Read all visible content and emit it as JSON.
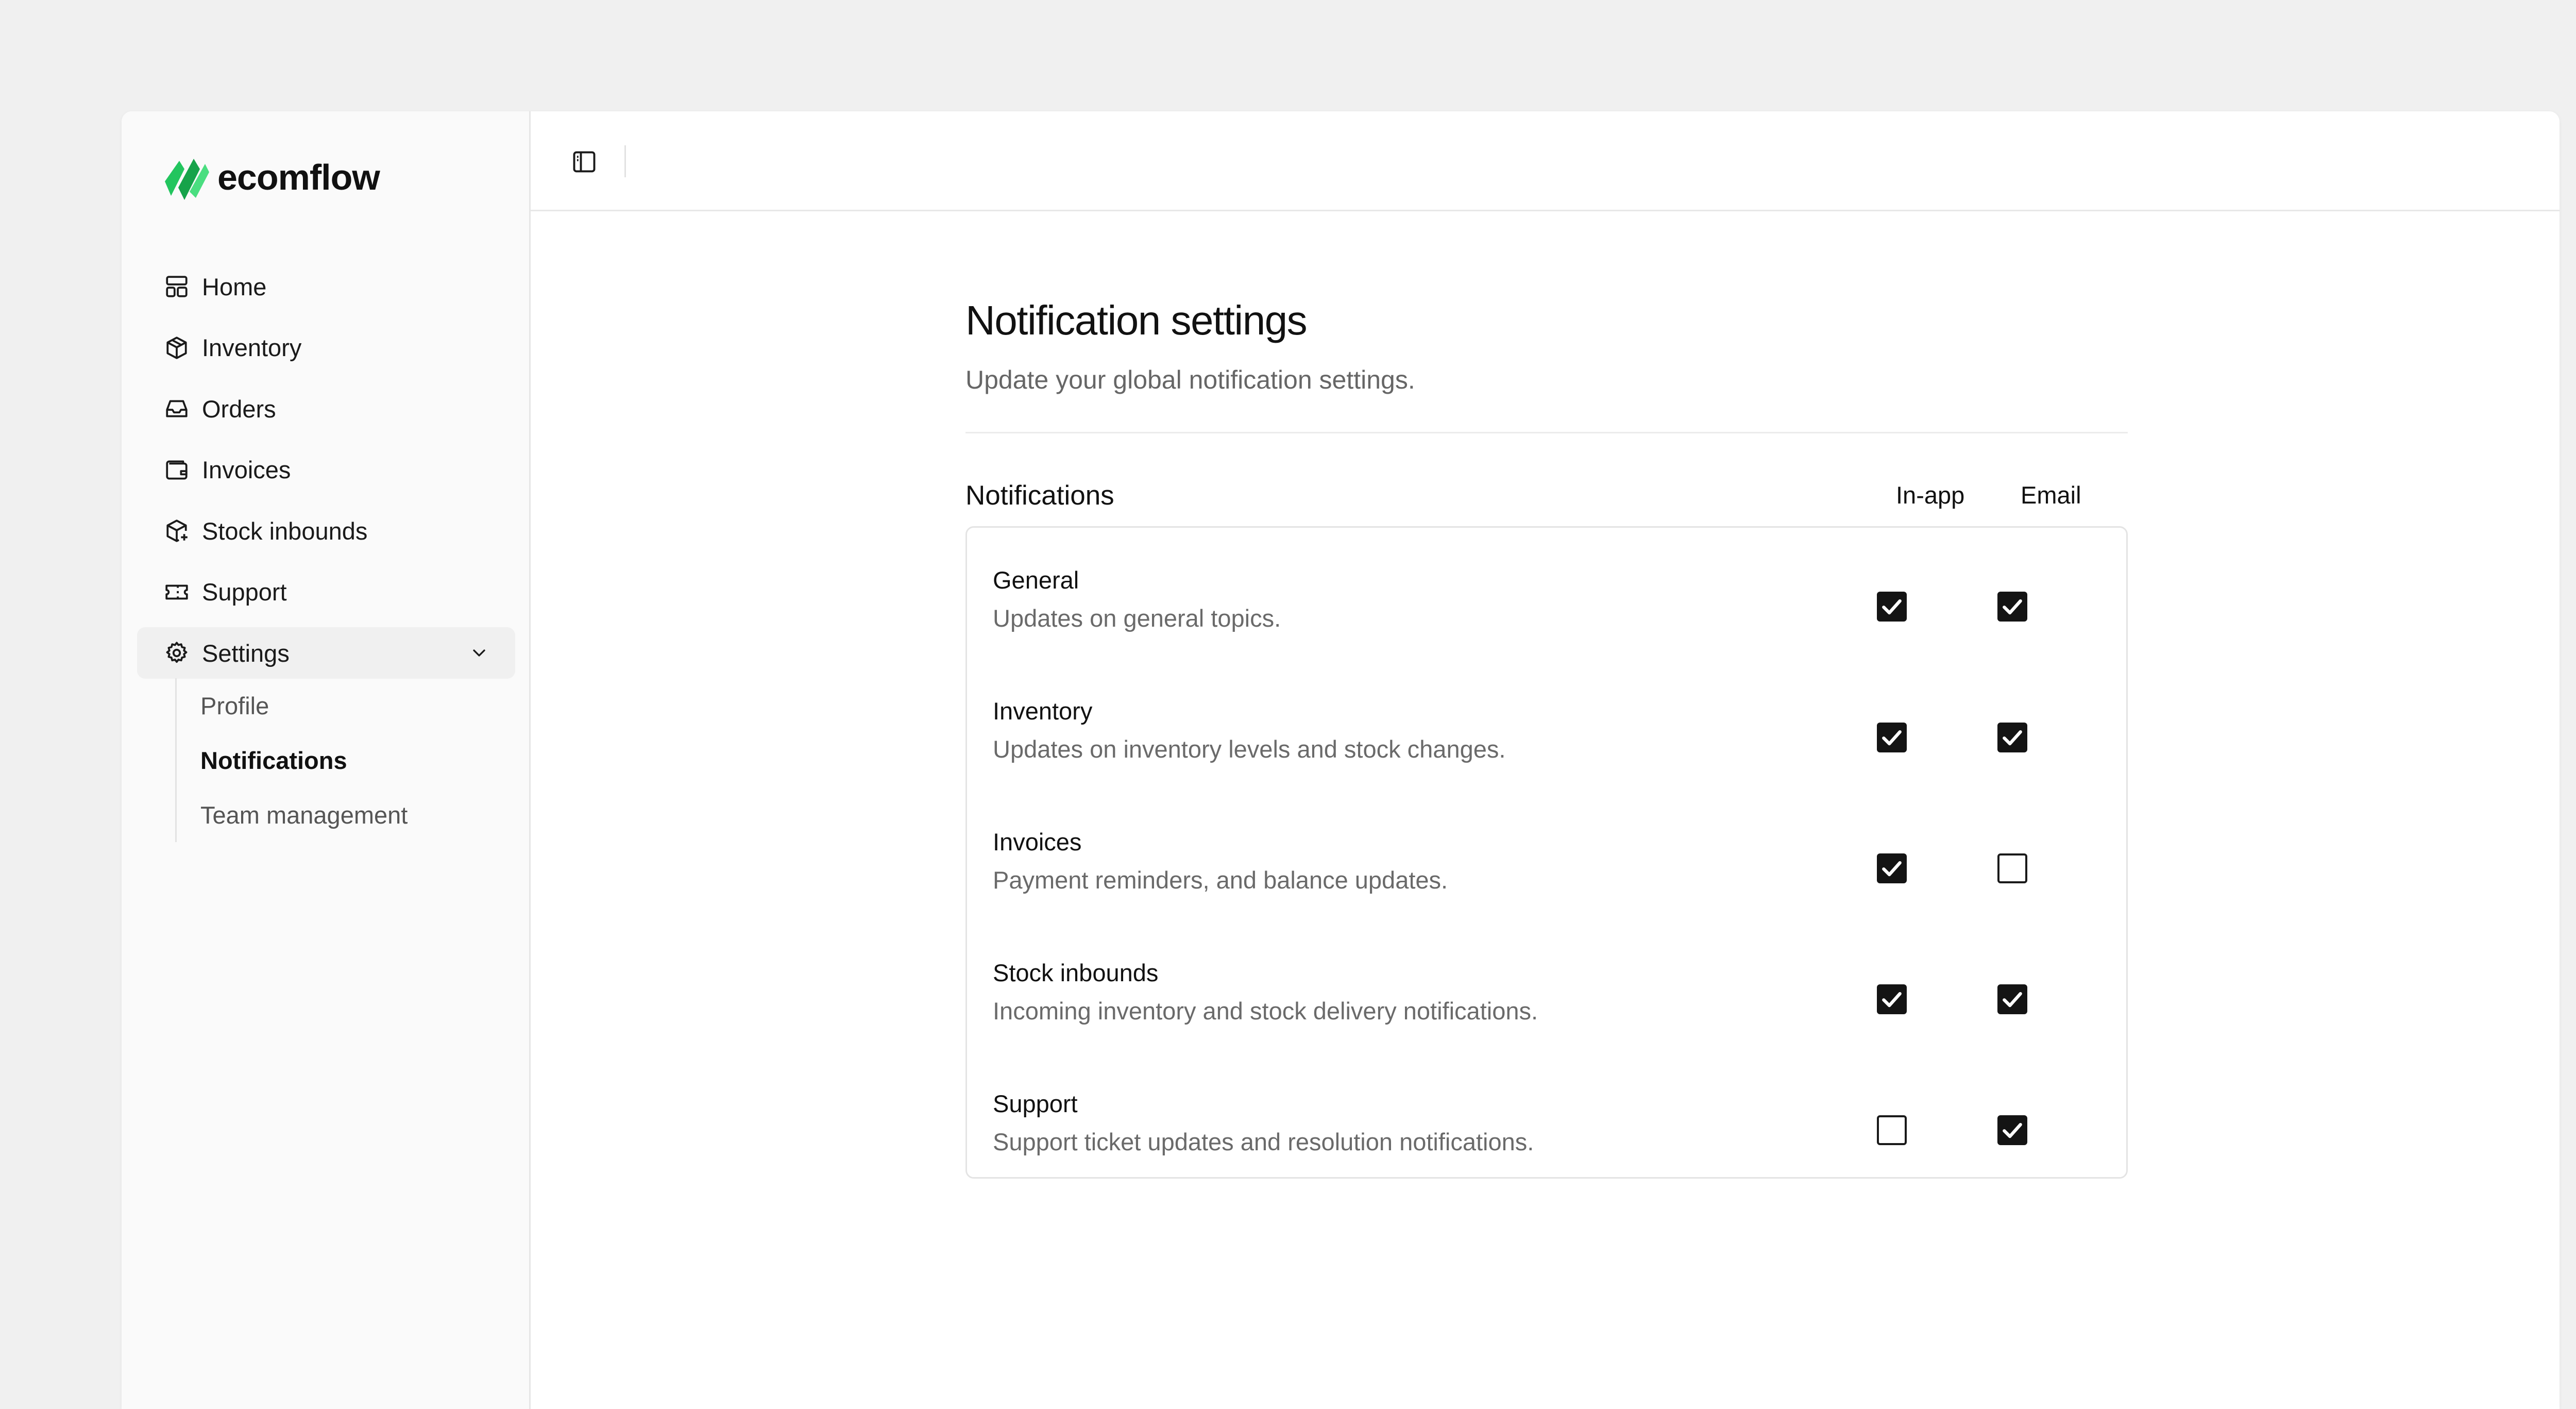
{
  "brand": {
    "name": "ecomflow",
    "accent": "#22c55e",
    "accent_dark": "#16a34a"
  },
  "sidebar": {
    "items": [
      {
        "label": "Home",
        "icon": "home-layout-icon"
      },
      {
        "label": "Inventory",
        "icon": "package-icon"
      },
      {
        "label": "Orders",
        "icon": "inbox-icon"
      },
      {
        "label": "Invoices",
        "icon": "wallet-icon"
      },
      {
        "label": "Stock inbounds",
        "icon": "package-plus-icon"
      },
      {
        "label": "Support",
        "icon": "ticket-icon"
      }
    ],
    "settings": {
      "label": "Settings",
      "icon": "gear-icon",
      "expanded": true,
      "children": [
        {
          "label": "Profile"
        },
        {
          "label": "Notifications",
          "current": true
        },
        {
          "label": "Team management"
        }
      ]
    }
  },
  "topbar": {
    "toggle_icon": "sidebar-toggle-icon"
  },
  "page": {
    "title": "Notification settings",
    "subtitle": "Update your global notification settings."
  },
  "table": {
    "title": "Notifications",
    "columns": [
      "In-app",
      "Email"
    ],
    "rows": [
      {
        "title": "General",
        "description": "Updates on general topics.",
        "in_app": true,
        "email": true
      },
      {
        "title": "Inventory",
        "description": "Updates on inventory levels and stock changes.",
        "in_app": true,
        "email": true
      },
      {
        "title": "Invoices",
        "description": "Payment reminders, and balance updates.",
        "in_app": true,
        "email": false
      },
      {
        "title": "Stock inbounds",
        "description": "Incoming inventory and stock delivery notifications.",
        "in_app": true,
        "email": true
      },
      {
        "title": "Support",
        "description": "Support ticket updates and resolution notifications.",
        "in_app": false,
        "email": true
      }
    ]
  }
}
